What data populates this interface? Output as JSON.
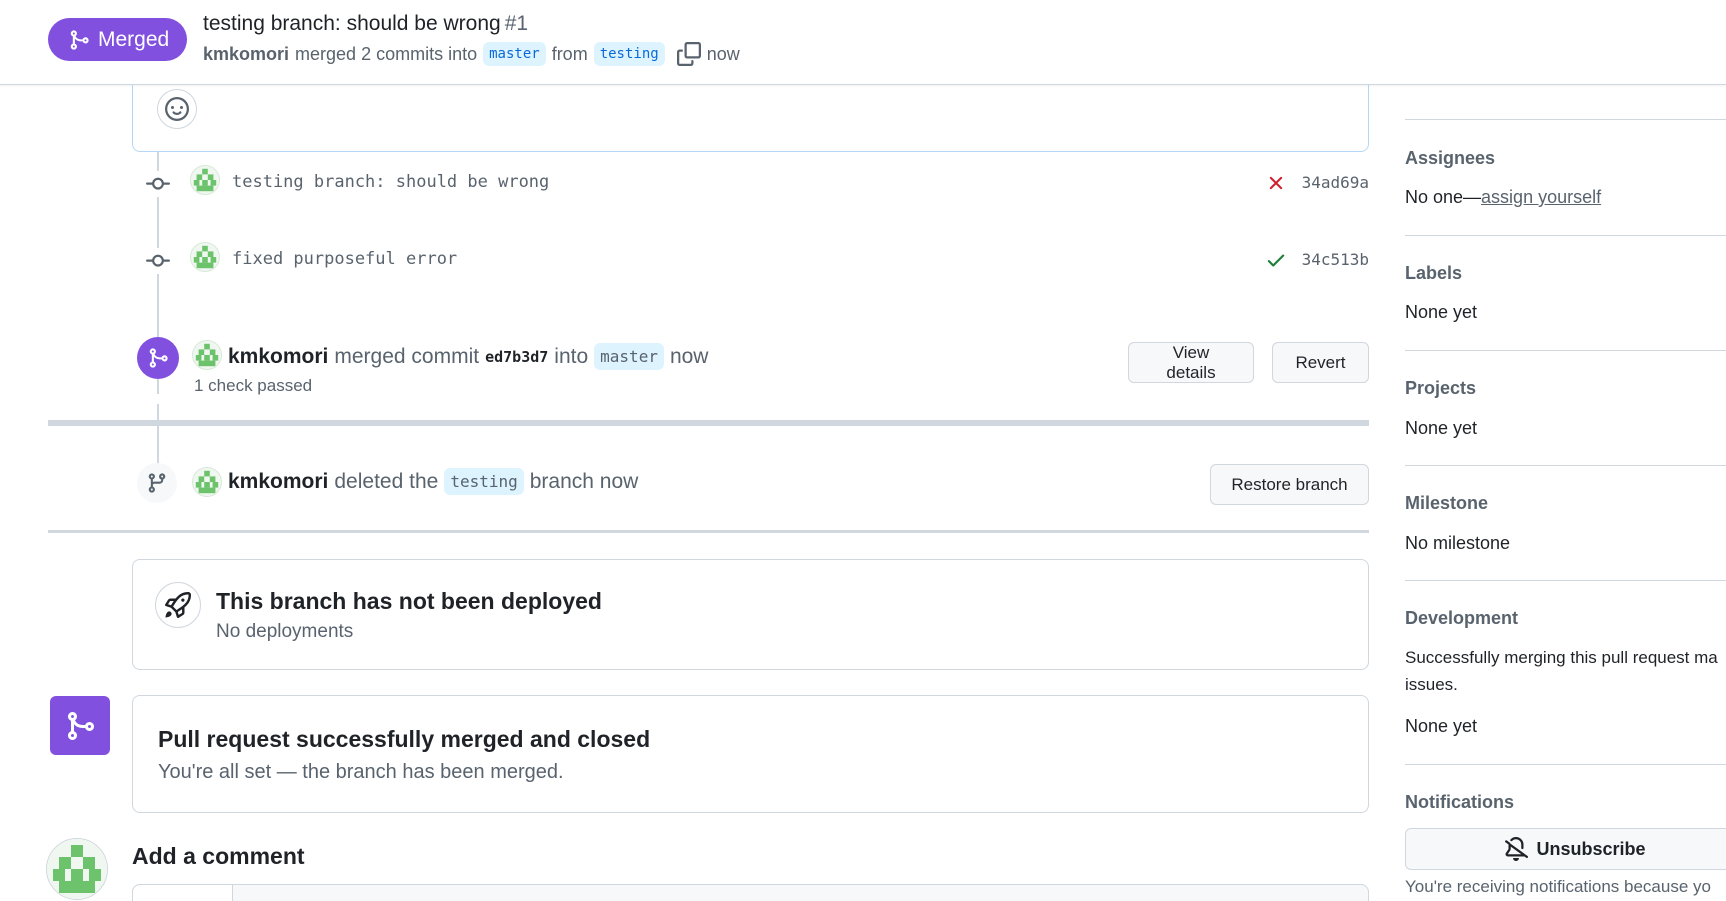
{
  "header": {
    "state_label": "Merged",
    "title": "testing branch: should be wrong",
    "number": "#1",
    "author": "kmkomori",
    "merged_text": "merged 2 commits into",
    "base_branch": "master",
    "from_text": "from",
    "head_branch": "testing",
    "time": "now"
  },
  "commits": [
    {
      "message": "testing branch: should be wrong",
      "status": "failure",
      "sha": "34ad69a"
    },
    {
      "message": "fixed purposeful error",
      "status": "success",
      "sha": "34c513b"
    }
  ],
  "merge_event": {
    "author": "kmkomori",
    "action": "merged commit",
    "sha": "ed7b3d7",
    "into_text": "into",
    "branch": "master",
    "time": "now",
    "checks": "1 check passed",
    "view_details_label": "View details",
    "revert_label": "Revert"
  },
  "delete_event": {
    "author": "kmkomori",
    "action": "deleted the",
    "branch": "testing",
    "suffix": "branch now",
    "restore_label": "Restore branch"
  },
  "deployment": {
    "title": "This branch has not been deployed",
    "subtitle": "No deployments"
  },
  "merged_box": {
    "title": "Pull request successfully merged and closed",
    "subtitle": "You're all set — the branch has been merged."
  },
  "add_comment": {
    "title": "Add a comment"
  },
  "sidebar": {
    "assignees": {
      "heading": "Assignees",
      "value": "No one—",
      "link": "assign yourself"
    },
    "labels": {
      "heading": "Labels",
      "value": "None yet"
    },
    "projects": {
      "heading": "Projects",
      "value": "None yet"
    },
    "milestone": {
      "heading": "Milestone",
      "value": "No milestone"
    },
    "development": {
      "heading": "Development",
      "line1": "Successfully merging this pull request ma",
      "line2": "issues.",
      "value": "None yet"
    },
    "notifications": {
      "heading": "Notifications",
      "button_label": "Unsubscribe",
      "note": "You're receiving notifications because yo"
    }
  },
  "colors": {
    "merged_purple": "#8250df",
    "success_green": "#1a7f37",
    "failure_red": "#cf222e",
    "branch_bg": "#ddf4ff",
    "link_blue": "#0969da"
  },
  "icons": {
    "merge": "git-merge-icon",
    "copy": "copy-icon",
    "smiley": "smiley-icon",
    "commit": "git-commit-icon",
    "x": "x-icon",
    "check": "check-icon",
    "branch": "git-branch-icon",
    "rocket": "rocket-icon",
    "bell_slash": "bell-slash-icon"
  }
}
